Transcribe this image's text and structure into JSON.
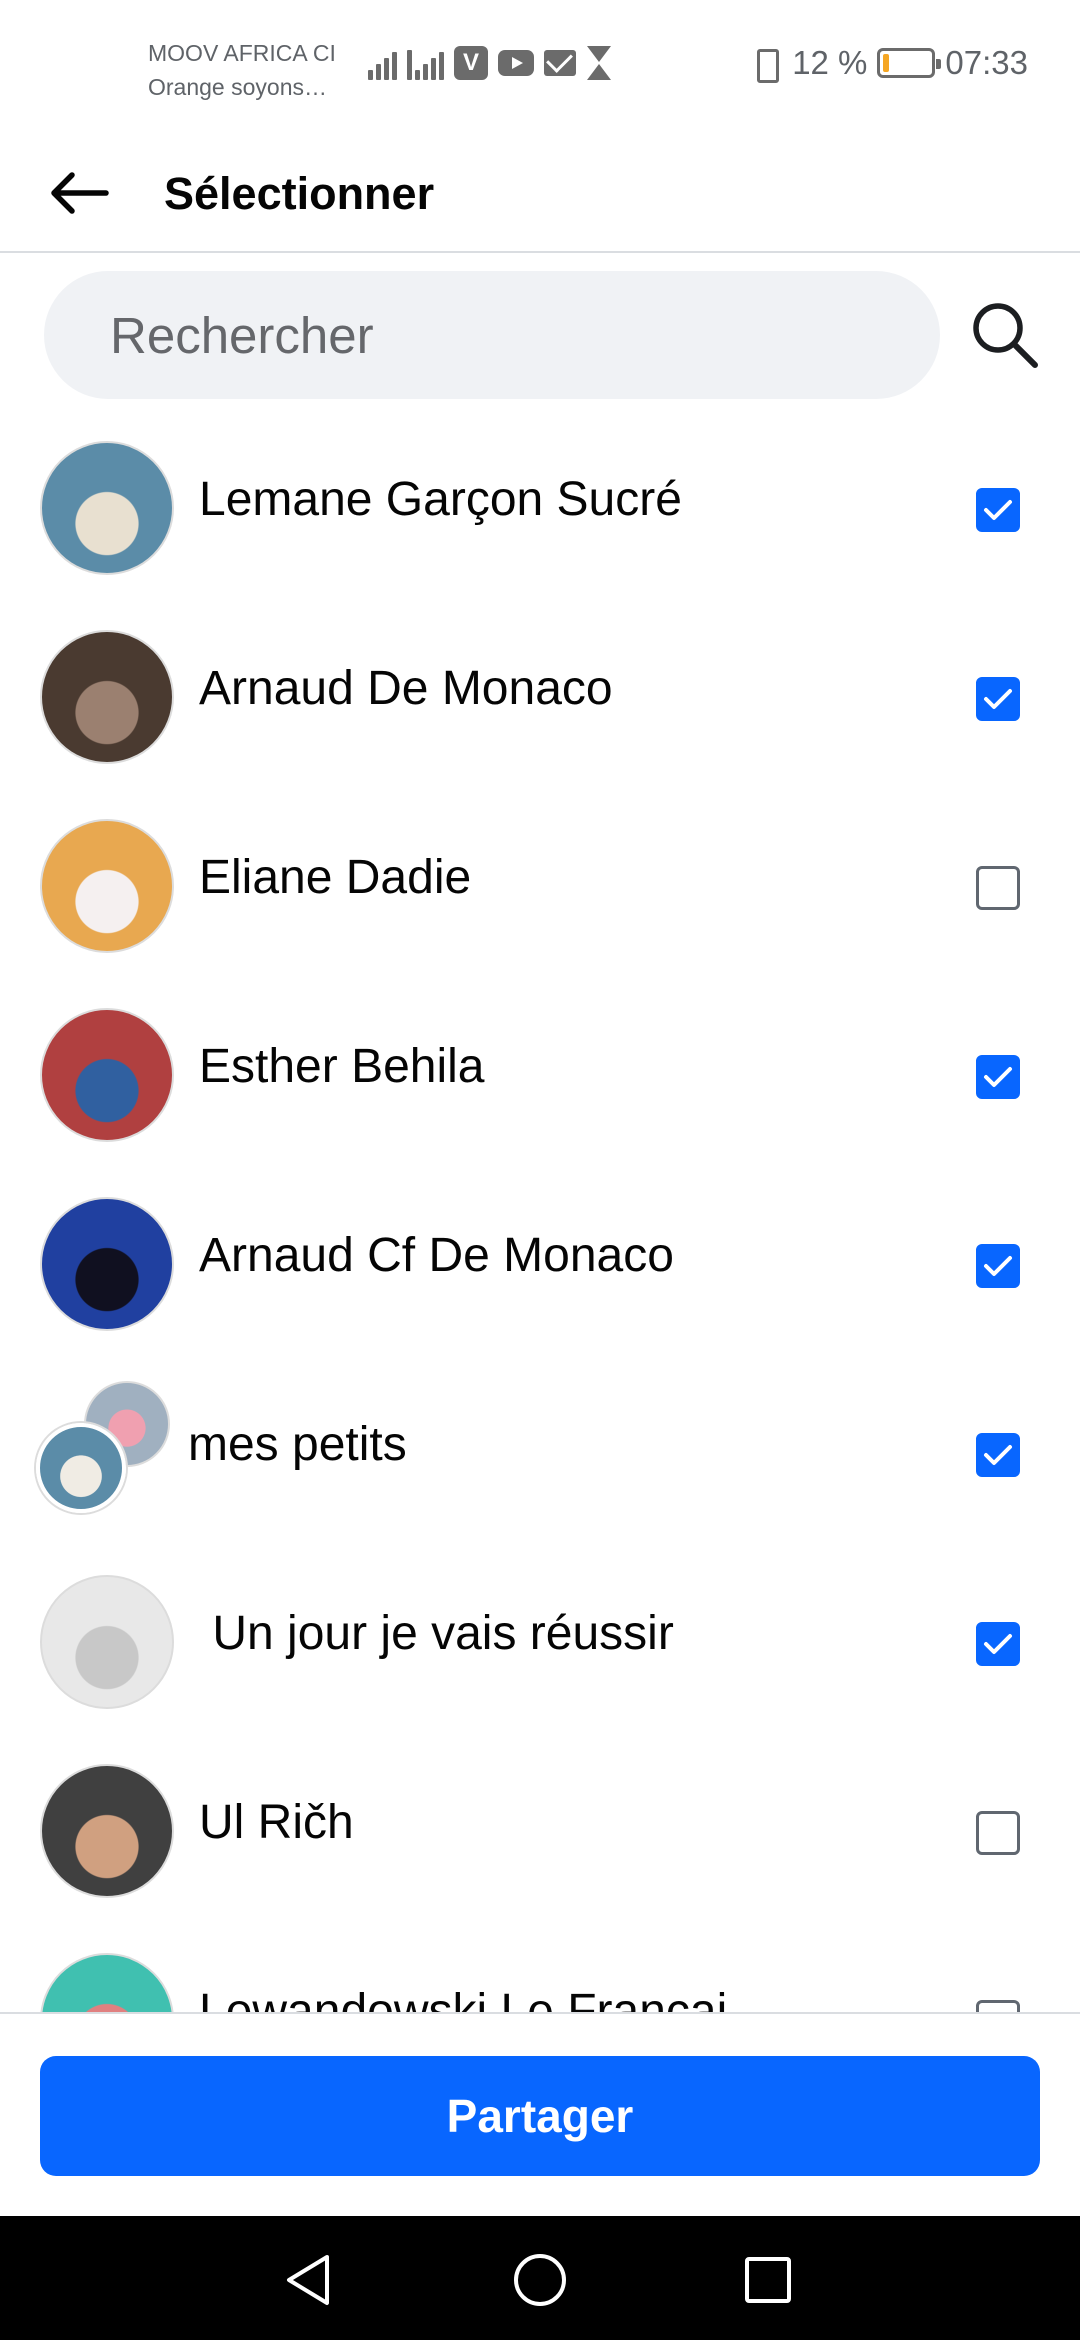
{
  "status_bar": {
    "carrier_primary": "MOOV AFRICA CI",
    "carrier_secondary": "Orange soyons…",
    "notification_icons": [
      "signal-icon",
      "hplus-signal-icon",
      "app-v-icon",
      "youtube-icon",
      "gmail-icon",
      "hourglass-icon"
    ],
    "app_v_letter": "V",
    "battery_text": "12 %",
    "battery_level": 0.12,
    "battery_color": "#f5a623",
    "time": "07:33"
  },
  "header": {
    "back_icon": "arrow-left-icon",
    "title": "Sélectionner"
  },
  "search": {
    "placeholder": "Rechercher",
    "icon": "search-icon"
  },
  "contacts": [
    {
      "name": "Lemane Garçon Sucré",
      "checked": true
    },
    {
      "name": "Arnaud De Monaco",
      "checked": true
    },
    {
      "name": "Eliane Dadie",
      "checked": false
    },
    {
      "name": "Esther Behila",
      "checked": true
    },
    {
      "name": "Arnaud Cf De Monaco",
      "checked": true
    },
    {
      "name": "mes petits",
      "checked": true,
      "group": true
    },
    {
      "name": " Un jour je vais réussir",
      "checked": true
    },
    {
      "name": "Ul Ričh",
      "checked": false
    },
    {
      "name": "Lewandowski Le Francai",
      "checked": false
    }
  ],
  "share_button": {
    "label": "Partager"
  },
  "nav_bar": {
    "back_icon": "nav-back-triangle-icon",
    "home_icon": "nav-home-circle-icon",
    "recents_icon": "nav-recents-square-icon"
  },
  "colors": {
    "accent": "#0866ff",
    "search_bg": "#f0f2f5",
    "text_primary": "#050505",
    "text_secondary": "#65676b"
  }
}
